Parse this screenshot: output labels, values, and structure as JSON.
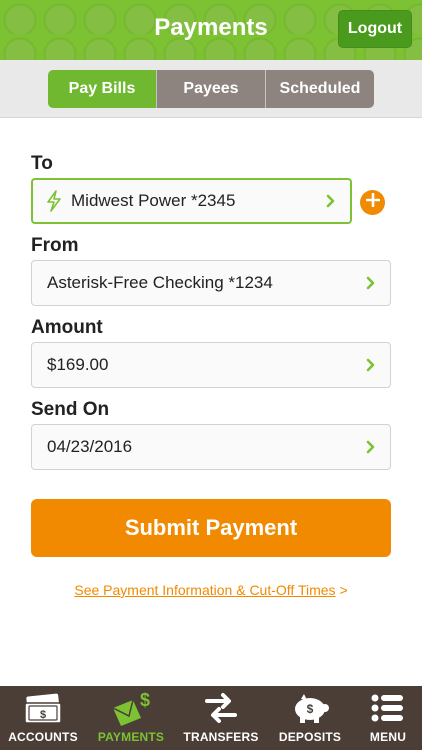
{
  "header": {
    "title": "Payments",
    "logout_label": "Logout"
  },
  "segments": [
    {
      "label": "Pay Bills"
    },
    {
      "label": "Payees"
    },
    {
      "label": "Scheduled"
    }
  ],
  "form": {
    "to": {
      "label": "To",
      "value": "Midwest Power *2345"
    },
    "from": {
      "label": "From",
      "value": "Asterisk-Free Checking *1234"
    },
    "amount": {
      "label": "Amount",
      "value": "$169.00"
    },
    "send_on": {
      "label": "Send On",
      "value": "04/23/2016"
    }
  },
  "submit_label": "Submit Payment",
  "info_link": {
    "text": "See Payment Information & Cut-Off Times",
    "suffix": ">"
  },
  "tabbar": [
    {
      "label": "ACCOUNTS",
      "icon": "cash-icon"
    },
    {
      "label": "PAYMENTS",
      "icon": "money-envelope-icon"
    },
    {
      "label": "TRANSFERS",
      "icon": "transfer-arrows-icon"
    },
    {
      "label": "DEPOSITS",
      "icon": "piggy-bank-icon"
    },
    {
      "label": "MENU",
      "icon": "menu-list-icon"
    }
  ],
  "colors": {
    "brand_green": "#7cc232",
    "accent_orange": "#f18a00",
    "nav_brown": "#4a3e37",
    "segment_gray": "#8d837f"
  }
}
